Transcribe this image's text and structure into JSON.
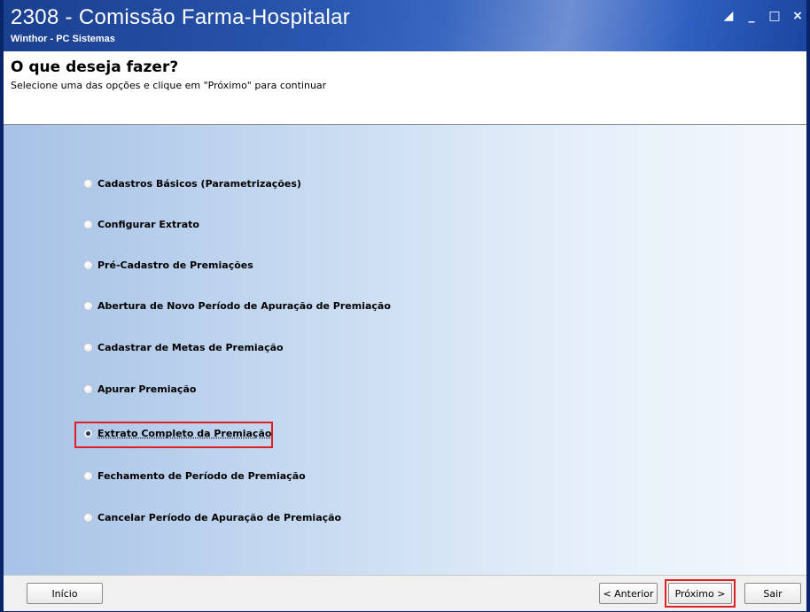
{
  "window": {
    "title": "2308 - Comissão Farma-Hospitalar",
    "subtitle": "Winthor - PC Sistemas"
  },
  "header": {
    "heading": "O que deseja fazer?",
    "instruction": "Selecione uma das opções e clique em \"Próximo\" para continuar"
  },
  "options": [
    {
      "label": "Cadastros Básicos (Parametrizações)",
      "checked": false
    },
    {
      "label": "Configurar Extrato",
      "checked": false
    },
    {
      "label": "Pré-Cadastro de Premiações",
      "checked": false
    },
    {
      "label": "Abertura de Novo Período de Apuração de Premiação",
      "checked": false
    },
    {
      "label": "Cadastrar de Metas de Premiação",
      "checked": false
    },
    {
      "label": "Apurar Premiação",
      "checked": false
    },
    {
      "label": "Extrato Completo da Premiação",
      "checked": true
    },
    {
      "label": "Fechamento de Período de Premiação",
      "checked": false
    },
    {
      "label": "Cancelar Período de Apuração de  Premiação",
      "checked": false
    }
  ],
  "footer": {
    "inicio": "Início",
    "anterior": "< Anterior",
    "proximo": "Próximo >",
    "sair": "Sair"
  },
  "colors": {
    "highlight": "#e02020",
    "titlebar": "#2a57b0"
  }
}
